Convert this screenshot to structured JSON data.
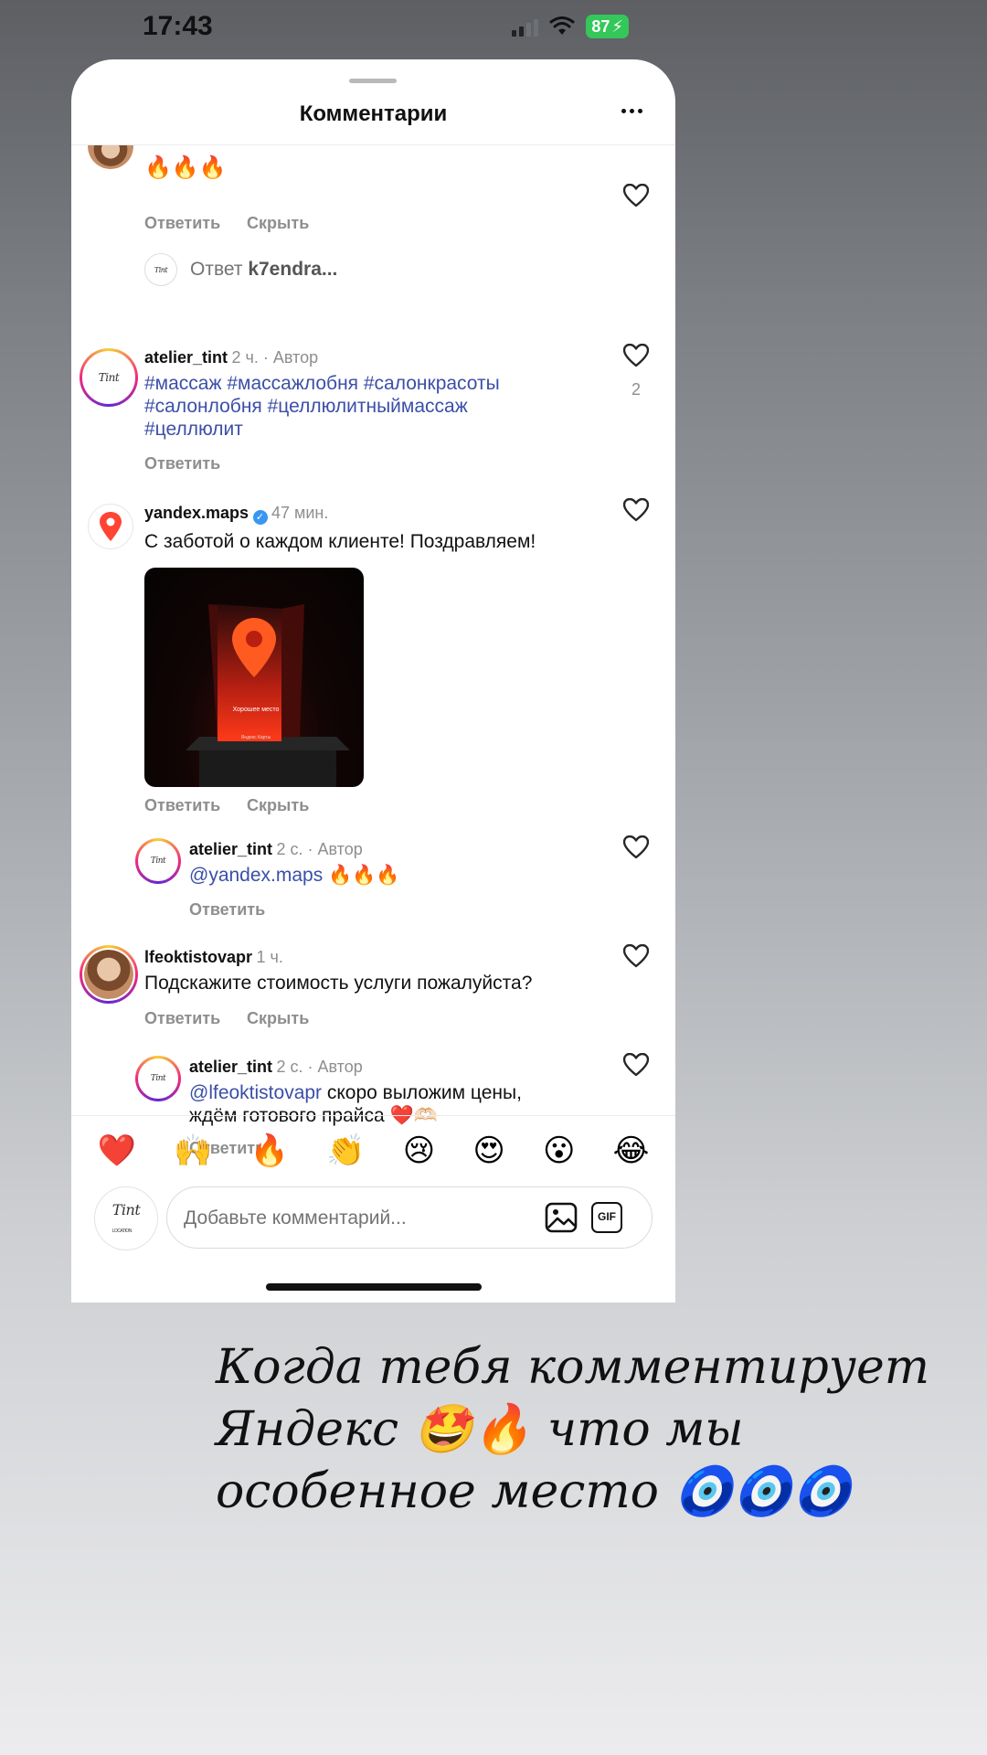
{
  "status_bar": {
    "time": "17:43",
    "battery": "87"
  },
  "sheet": {
    "title": "Комментарии"
  },
  "comments": [
    {
      "id": "c1",
      "emojis": "🔥🔥🔥",
      "actions": [
        "Ответить",
        "Скрыть"
      ]
    },
    {
      "id": "reply-row",
      "label": "Ответ",
      "user": "k7endra..."
    },
    {
      "id": "c2",
      "username": "atelier_tint",
      "meta": "2 ч. · Автор",
      "text_line1": "#массаж #массажлобня #салонкрасоты",
      "text_line2": "#салонлобня #целлюлитныймассаж",
      "text_line3": "#целлюлит",
      "likes": "2",
      "actions": [
        "Ответить"
      ]
    },
    {
      "id": "c3",
      "username": "yandex.maps",
      "meta": "47 мин.",
      "text": "С заботой о каждом клиенте! Поздравляем!",
      "image_text": "Хорошее место",
      "image_sub": "Яндекс Карты",
      "actions": [
        "Ответить",
        "Скрыть"
      ]
    },
    {
      "id": "c4",
      "username": "atelier_tint",
      "meta": "2 с. · Автор",
      "mention": "@yandex.maps",
      "emojis": "🔥🔥🔥",
      "actions": [
        "Ответить"
      ]
    },
    {
      "id": "c5",
      "username": "lfeoktistovapr",
      "meta": "1 ч.",
      "text": "Подскажите стоимость услуги пожалуйста?",
      "actions": [
        "Ответить",
        "Скрыть"
      ]
    },
    {
      "id": "c6",
      "username": "atelier_tint",
      "meta": "2 с. · Автор",
      "mention": "@lfeoktistovapr",
      "text_rest": " скоро выложим цены,",
      "text_line2": "ждём готового прайса ❤️🫶🏻",
      "actions": [
        "Ответить"
      ]
    }
  ],
  "reactions": [
    "❤️",
    "🙌",
    "🔥",
    "👏",
    "😢",
    "😍",
    "😮",
    "😂"
  ],
  "composer": {
    "placeholder": "Добавьте комментарий...",
    "gif_label": "GIF"
  },
  "logo": {
    "main": "Tint",
    "sub": "LOCATION"
  },
  "caption": {
    "line1": "Когда тебя комментирует",
    "line2": "Яндекс 🤩🔥 что мы",
    "line3": "особенное место 🧿🧿🧿"
  },
  "colors": {
    "hashtag": "#3b4fa8",
    "verified": "#3897f0",
    "battery": "#34c759"
  }
}
